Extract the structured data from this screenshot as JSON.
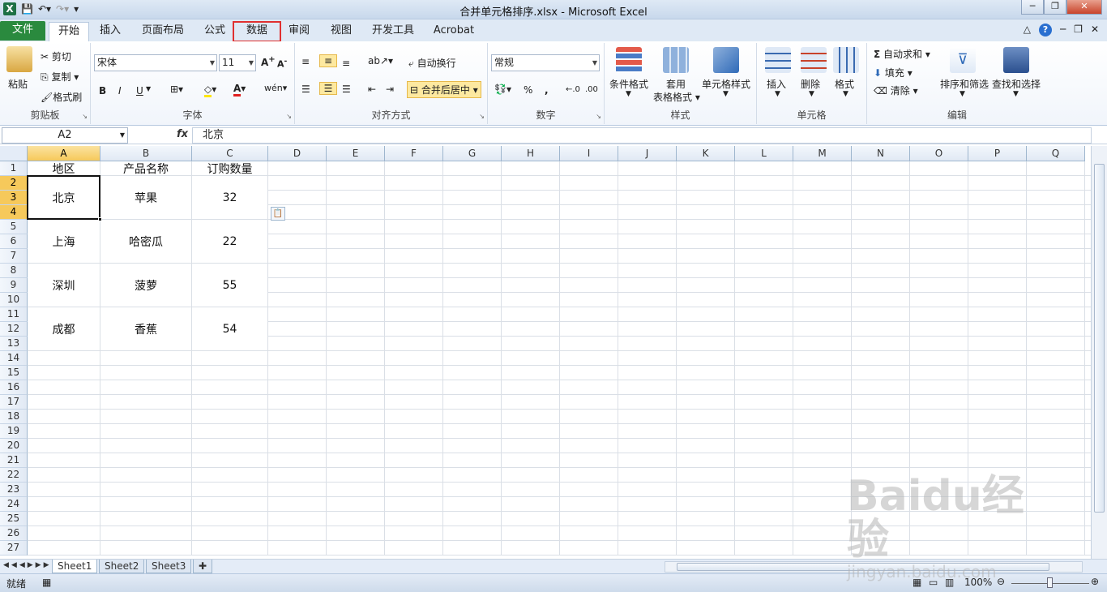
{
  "window": {
    "title": "合并单元格排序.xlsx - Microsoft Excel"
  },
  "ribbon_tabs": [
    "文件",
    "开始",
    "插入",
    "页面布局",
    "公式",
    "数据",
    "审阅",
    "视图",
    "开发工具",
    "Acrobat"
  ],
  "clipboard": {
    "paste": "粘贴",
    "cut": "剪切",
    "copy": "复制",
    "format_painter": "格式刷",
    "label": "剪贴板"
  },
  "font": {
    "name": "宋体",
    "size": "11",
    "label": "字体",
    "bold": "B",
    "italic": "I",
    "underline": "U"
  },
  "alignment": {
    "wrap": "自动换行",
    "merge": "合并后居中",
    "label": "对齐方式"
  },
  "number": {
    "format": "常规",
    "label": "数字",
    "percent": "%",
    "comma": ","
  },
  "styles": {
    "conditional": "条件格式",
    "table_fmt_1": "套用",
    "table_fmt_2": "表格格式",
    "cell_styles": "单元格样式",
    "label": "样式"
  },
  "cells": {
    "insert": "插入",
    "delete": "删除",
    "format": "格式",
    "label": "单元格"
  },
  "editing": {
    "autosum": "自动求和",
    "fill": "填充",
    "clear": "清除",
    "sort_filter": "排序和筛选",
    "find_select": "查找和选择",
    "label": "编辑"
  },
  "formula_bar": {
    "name_box": "A2",
    "fx": "fx",
    "content": "北京"
  },
  "columns": [
    "A",
    "B",
    "C",
    "D",
    "E",
    "F",
    "G",
    "H",
    "I",
    "J",
    "K",
    "L",
    "M",
    "N",
    "O",
    "P",
    "Q"
  ],
  "rows": [
    "1",
    "2",
    "3",
    "4",
    "5",
    "6",
    "7",
    "8",
    "9",
    "10",
    "11",
    "12",
    "13",
    "14",
    "15",
    "16",
    "17",
    "18",
    "19",
    "20",
    "21",
    "22",
    "23",
    "24",
    "25",
    "26",
    "27"
  ],
  "table": {
    "headers": [
      "地区",
      "产品名称",
      "订购数量"
    ],
    "rows": [
      [
        "北京",
        "苹果",
        "32"
      ],
      [
        "上海",
        "哈密瓜",
        "22"
      ],
      [
        "深圳",
        "菠萝",
        "55"
      ],
      [
        "成都",
        "香蕉",
        "54"
      ]
    ]
  },
  "sheets": [
    "Sheet1",
    "Sheet2",
    "Sheet3"
  ],
  "status": {
    "ready": "就绪",
    "zoom": "100%"
  },
  "watermark": {
    "brand": "Baidu经验",
    "url": "jingyan.baidu.com"
  }
}
